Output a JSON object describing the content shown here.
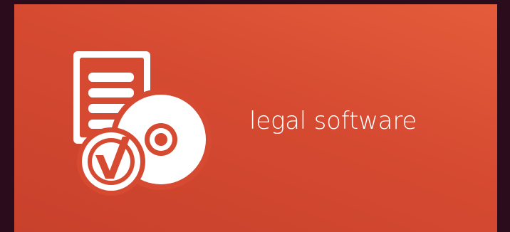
{
  "tile": {
    "label": "legal software",
    "background_color": "#d54a31",
    "icon": "document-disc-checkmark-icon"
  },
  "frame": {
    "background_color": "#2a0c1c"
  }
}
